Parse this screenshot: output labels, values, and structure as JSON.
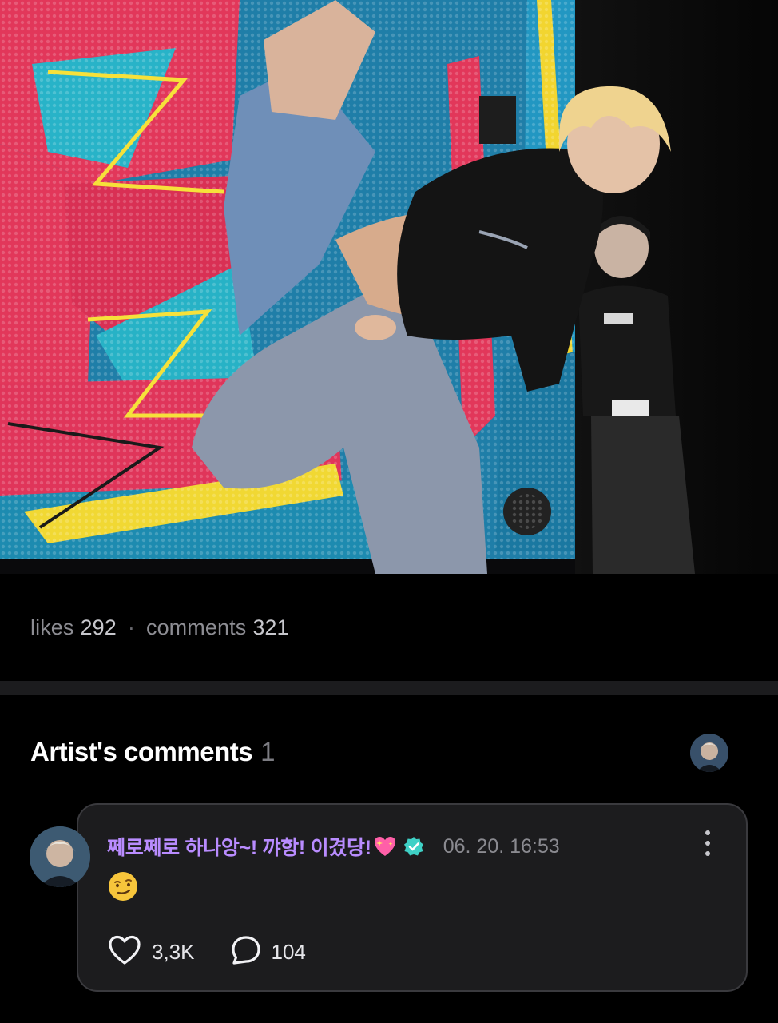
{
  "stats": {
    "likes_label": "likes",
    "likes_count": "292",
    "separator": "·",
    "comments_label": "comments",
    "comments_count": "321"
  },
  "artist_section": {
    "title": "Artist's comments",
    "count": "1",
    "avatar_icon": "artist-avatar"
  },
  "comment": {
    "author": "쩨로쩨로 하나앙~! 꺄항! 이겼당!",
    "author_emoji": "sparkling-heart-emoji",
    "verified_icon": "verified-badge-icon",
    "timestamp": "06. 20. 16:53",
    "body_emoji": "smirking-face-emoji",
    "likes": "3,3K",
    "replies": "104",
    "more_icon": "more-vertical-icon"
  },
  "colors": {
    "background": "#000000",
    "card": "#1c1c1e",
    "author": "#b98cff",
    "verified": "#3fd1c6",
    "muted": "#8a8a90"
  }
}
